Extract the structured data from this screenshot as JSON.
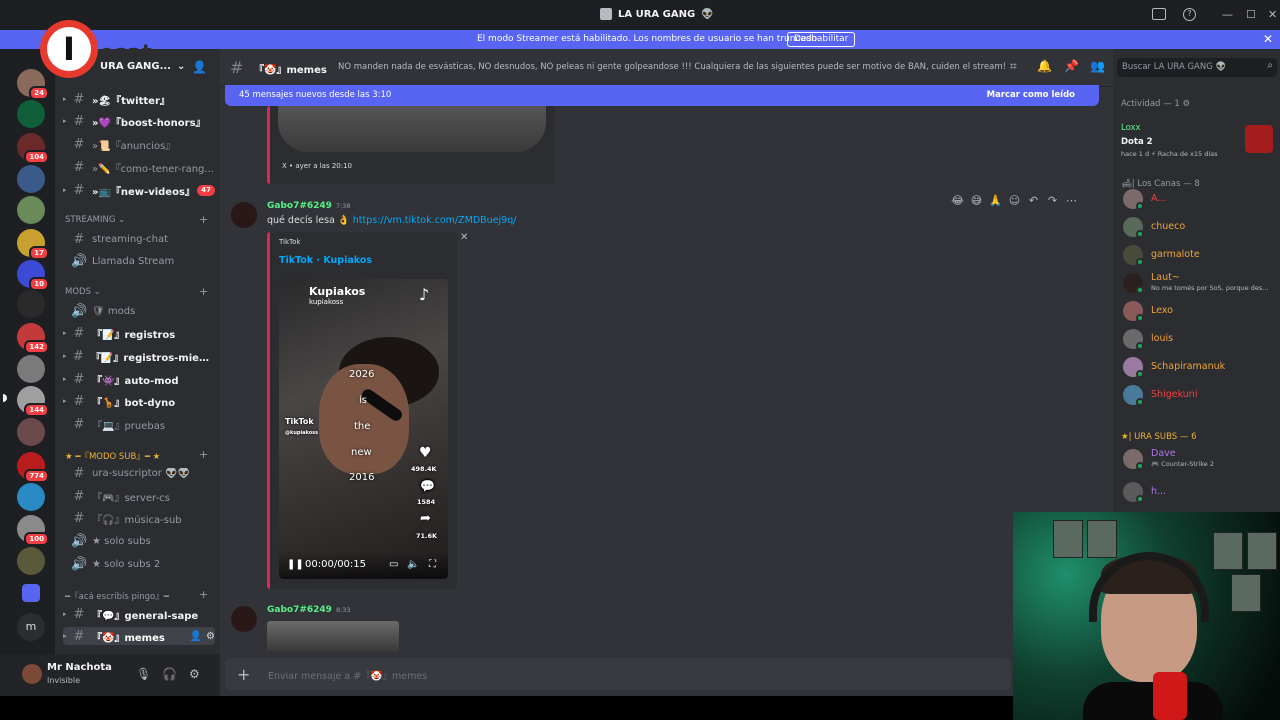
{
  "window": {
    "title": "LA URA GANG"
  },
  "banner": {
    "text": "El modo Streamer está habilitado. Los nombres de usuario se han truncado.",
    "button": "Deshabilitar",
    "close": "✕"
  },
  "watermark": {
    "letter": "I",
    "text": "esat"
  },
  "rail": {
    "badges": [
      "24",
      "104",
      "17",
      "10",
      "142",
      "144",
      "774",
      "100"
    ]
  },
  "server": {
    "name": "URA GANG...",
    "chevron": "⌄"
  },
  "channels": [
    {
      "label": "»🏖『twitter』",
      "bold": true
    },
    {
      "label": "»💜『boost-honors』",
      "bold": true
    },
    {
      "label": "»📜『anuncios』",
      "bold": false
    },
    {
      "label": "»✏️『como-tener-rang...",
      "bold": false
    },
    {
      "label": "»📺『new-videos』",
      "bold": true,
      "count": "47"
    }
  ],
  "categories": {
    "streaming": "STREAMING ⌄",
    "mods": "mods ⌄",
    "modo_sub": "★ ━『MODO SUB』━ ★",
    "aca": "━『acá escribís pingo』━"
  },
  "streaming_channels": [
    "streaming-chat",
    "Llamada Stream"
  ],
  "mods_channels": [
    {
      "label": "🛡 mods",
      "bold": false
    },
    {
      "label": "『📝』registros",
      "bold": true
    },
    {
      "label": "『📝』registros-miem...",
      "bold": true
    },
    {
      "label": "『👾』auto-mod",
      "bold": true
    },
    {
      "label": "『🦒』bot-dyno",
      "bold": true
    },
    {
      "label": "『💻』pruebas",
      "bold": false
    }
  ],
  "sub_channels": [
    "ura-suscriptor 👽👽",
    "『🎮』server-cs",
    "『🎧』música-sub",
    "★ solo subs",
    "★ solo subs 2"
  ],
  "aca_channels": [
    {
      "label": "『💬』general-sape",
      "bold": true
    },
    {
      "label": "『🤡』memes",
      "bold": true,
      "active": true
    }
  ],
  "user": {
    "name": "Mr Nachota",
    "status": "Invisible"
  },
  "topbar": {
    "channel": "『🤡』memes",
    "topic": "NO manden nada de esvásticas, NO desnudos, NO peleas ni gente golpeandose !!! Cualquiera de las siguientes puede ser motivo de BAN, cuiden el stream!"
  },
  "newbar": {
    "text": "45 mensajes nuevos desde las 3:10",
    "action": "Marcar como leído"
  },
  "old_embed": {
    "footer": "X • ayer a las 20:10"
  },
  "message1": {
    "author": "Gabo7#6249",
    "time": "7:38",
    "text": "qué decís lesa 👌",
    "link": "https://vm.tiktok.com/ZMDBuej9q/"
  },
  "tiktok_embed": {
    "provider": "TikTok",
    "title": "TikTok · Kupiakos",
    "user": "Kupiakos",
    "handle": "kupiakoss",
    "lines": [
      "2026",
      "is",
      "the",
      "new",
      "2016"
    ],
    "watermark": "TikTok",
    "watermark_handle": "@kupiakoss",
    "likes": "498.4K",
    "comments": "1584",
    "shares": "71.6K",
    "time": "00:00/00:15"
  },
  "message2": {
    "author": "Gabo7#6249",
    "time": "8:33"
  },
  "composer": {
    "placeholder": "Enviar mensaje a #『🤡』memes"
  },
  "members": {
    "search_placeholder": "Buscar LA URA GANG 👽",
    "activity_header": "Actividad — 1 ⚙",
    "activity": {
      "who": "Loxx",
      "game": "Dota 2",
      "meta": "hace 1 d  ⚡ Racha de x15 días"
    },
    "group1": "🛋| Los Canas — 8",
    "group1_members": [
      {
        "name": "A...",
        "color": "#f23f43"
      },
      {
        "name": "chueco",
        "color": "#f0a33a"
      },
      {
        "name": "garmalote",
        "color": "#f0a33a"
      },
      {
        "name": "Laut~",
        "color": "#f0a33a",
        "sub": "No me tomés por SoS, porque des..."
      },
      {
        "name": "Lexo",
        "color": "#f0a33a"
      },
      {
        "name": "louis",
        "color": "#f0a33a"
      },
      {
        "name": "Schapiramanuk",
        "color": "#f0a33a"
      },
      {
        "name": "Shigekuni",
        "color": "#f23f43"
      }
    ],
    "group2": "★| URA SUBS — 6",
    "group2_members": [
      {
        "name": "Dave",
        "color": "#b174e6",
        "sub": "🎮 Counter-Strike 2"
      },
      {
        "name": "h...",
        "color": "#b174e6"
      }
    ]
  }
}
